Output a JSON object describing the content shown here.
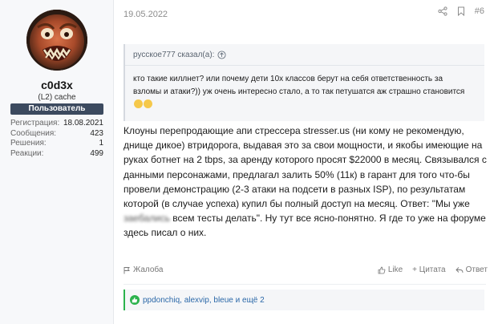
{
  "user": {
    "name": "c0d3x",
    "title": "(L2) cache",
    "role": "Пользователь",
    "stats": [
      {
        "label": "Регистрация:",
        "value": "18.08.2021"
      },
      {
        "label": "Сообщения:",
        "value": "423"
      },
      {
        "label": "Решения:",
        "value": "1"
      },
      {
        "label": "Реакции:",
        "value": "499"
      }
    ]
  },
  "post": {
    "date": "19.05.2022",
    "number": "#6",
    "quote": {
      "author_line": "русское777 сказал(а):",
      "text": "кто такие киллнет? или почему дети 10х классов берут на себя ответственность за взломы и атаки?)) уж очень интересно стало, а то так петушатся аж страшно становится"
    },
    "message_part1": "Клоуны перепродающие апи стрессера stresser.us (ни кому не рекомендую, днище дикое) втридорога, выдавая это за свои мощности, и якобы имеющие на руках ботнет на 2 tbps, за аренду которого просят $22000 в месяц. Связывался с данными персонажами, предлагал залить 50% (11к) в гарант для того что-бы провели демонстрацию (2-3 атаки на подсети в разных ISP), по результатам которой (в случае успеха) купил бы полный доступ на месяц. Ответ: \"Мы уже ",
    "message_blurred": "заебались",
    "message_part2": " всем тесты делать\". Ну тут все ясно-понятно. Я где то уже на форуме здесь писал о них.",
    "actions": {
      "report": "Жалоба",
      "like": "Like",
      "quote": "+ Цитата",
      "reply": "Ответ"
    },
    "reactions_text": "ppdonchiq, alexvip, bleue и ещё 2"
  },
  "colors": {
    "role_badge_bg": "#3c4a5f",
    "reaction_green": "#2bb24c",
    "link_blue": "#2b68a8"
  }
}
